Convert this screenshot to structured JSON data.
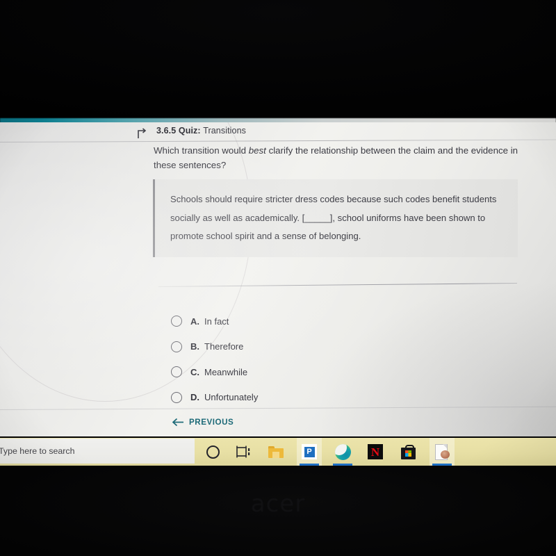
{
  "header": {
    "back_icon": "back-arrow-icon",
    "lesson_number": "3.6.5",
    "activity_type": "Quiz:",
    "activity_title": "Transitions"
  },
  "question": {
    "prefix": "Which transition would ",
    "emphasis": "best",
    "suffix": " clarify the relationship between the claim and the evidence in these sentences?"
  },
  "passage": {
    "text": "Schools should require stricter dress codes because such codes benefit students socially as well as academically. [_____], school uniforms have been shown to promote school spirit and a sense of belonging."
  },
  "options": [
    {
      "letter": "A.",
      "text": "In fact",
      "selected": false
    },
    {
      "letter": "B.",
      "text": "Therefore",
      "selected": false
    },
    {
      "letter": "C.",
      "text": "Meanwhile",
      "selected": false
    },
    {
      "letter": "D.",
      "text": "Unfortunately",
      "selected": false
    }
  ],
  "navigation": {
    "previous_label": "PREVIOUS",
    "previous_icon": "arrow-left-icon",
    "accent_color": "#1d6a78"
  },
  "taskbar": {
    "search_placeholder": "Type here to search",
    "cortana_icon": "cortana-circle-icon",
    "task_view_icon": "task-view-icon",
    "apps": [
      {
        "name": "file-explorer-icon",
        "label": "File Explorer",
        "active": false
      },
      {
        "name": "p-app-icon",
        "label": "P",
        "active": true
      },
      {
        "name": "microsoft-edge-icon",
        "label": "Microsoft Edge",
        "active": true
      },
      {
        "name": "netflix-icon",
        "label": "N",
        "active": false
      },
      {
        "name": "microsoft-store-icon",
        "label": "Microsoft Store",
        "active": false
      },
      {
        "name": "document-photo-icon",
        "label": "Document",
        "active": true
      }
    ],
    "background_color": "#e7dfa4"
  },
  "device": {
    "brand": "acer"
  }
}
